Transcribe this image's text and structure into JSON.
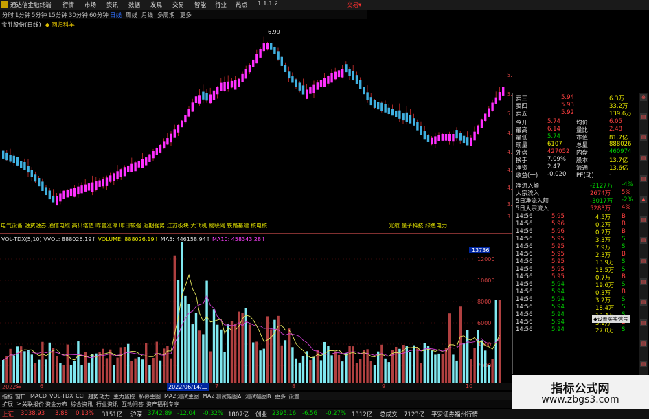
{
  "menubar": {
    "title": "通达信金融终端",
    "items": [
      "行情",
      "市场",
      "资讯",
      "数据",
      "发现",
      "交易",
      "智能",
      "行业",
      "热点",
      "1.1.1.2"
    ],
    "trade": "交易▾"
  },
  "periods": [
    "分时",
    "1分钟",
    "5分钟",
    "15分钟",
    "30分钟",
    "60分钟",
    "日线",
    "周线",
    "月线",
    "多周期",
    "更多"
  ],
  "active_period": "日线",
  "stock_header": {
    "name": "宝胜股份(日线)",
    "warn": "◆ 回归科羊"
  },
  "price_axis": [
    "5.50",
    "5.25",
    "5.00",
    "4.75",
    "4.50",
    "4.25",
    "4.00",
    "3.75",
    "3.50"
  ],
  "high_mark": "6.99",
  "concepts_left": "电气设备 融资融券 通信电缆 高贝塔值 昨曾涨停 昨日较强 近期强势 江苏板块 大飞机 物联网 铁路基建 核电核",
  "concepts_right": "光缆 量子科技 绿色电力",
  "vol_legend": {
    "label": "VOL-TDX(5,10)",
    "vvol": "VVOL: 888026.19↑",
    "volume": "VOLUME: 888026.19↑",
    "ma5": "MA5: 446158.94↑",
    "ma10": "MA10: 458343.28↑"
  },
  "vol_axis_top": "13736",
  "vol_axis": [
    "12000",
    "10000",
    "8000",
    "6000",
    "4000",
    "2000"
  ],
  "date_axis": {
    "left": "2022年",
    "cursor": "2022/06/14/二",
    "marks": [
      "6",
      "7",
      "8",
      "9",
      "10"
    ]
  },
  "bottom_tabs": [
    "指标",
    "窗口",
    "MACD",
    "VOL-TDX",
    "CCI",
    "趋势动力",
    "主力监控",
    "私募主图",
    "MA2",
    "测试主图",
    "MA2",
    "测试幅图A",
    "测试幅图B",
    "更多",
    "设置"
  ],
  "bottom_tabs2": [
    "扩展",
    ">",
    "关联报价",
    "资金分布",
    "综合资讯",
    "行业资讯",
    "互动问答",
    "资产福利专享"
  ],
  "right_panel": {
    "asks": [
      {
        "label": "卖三",
        "price": "5.94",
        "vol": "6.3万"
      },
      {
        "label": "卖四",
        "price": "5.93",
        "vol": "33.2万"
      },
      {
        "label": "卖五",
        "price": "5.92",
        "vol": "139.6万"
      }
    ],
    "stats": [
      {
        "l1": "今开",
        "v1": "5.74",
        "l2": "均价",
        "v2": "6.05"
      },
      {
        "l1": "最高",
        "v1": "6.14",
        "l2": "量比",
        "v2": "2.48"
      },
      {
        "l1": "最低",
        "v1": "5.74",
        "l2": "市值",
        "v2": "81.7亿"
      },
      {
        "l1": "现量",
        "v1": "6107",
        "l2": "总量",
        "v2": "888026"
      },
      {
        "l1": "外盘",
        "v1": "427052",
        "l2": "内盘",
        "v2": "460974"
      },
      {
        "l1": "换手",
        "v1": "7.09%",
        "l2": "股本",
        "v2": "13.7亿"
      },
      {
        "l1": "净资",
        "v1": "2.47",
        "l2": "流通",
        "v2": "13.6亿"
      },
      {
        "l1": "收益(一)",
        "v1": "-0.020",
        "l2": "PE(动)",
        "v2": "-"
      }
    ],
    "flows": [
      {
        "label": "净流入额",
        "value": "-2127万",
        "pct": "-4%"
      },
      {
        "label": "大宗流入",
        "value": "2674万",
        "pct": "5%"
      },
      {
        "label": "5日净流入额",
        "value": "-3017万",
        "pct": "-2%"
      },
      {
        "label": "5日大宗流入",
        "value": "5283万",
        "pct": "4%"
      }
    ],
    "ticks": [
      {
        "t": "14:56",
        "p": "5.95",
        "v": "4.5万",
        "s": "B"
      },
      {
        "t": "14:56",
        "p": "5.96",
        "p2": "",
        "v": "0.2万",
        "s": "B"
      },
      {
        "t": "14:56",
        "p": "5.96",
        "v": "0.2万",
        "s": "B"
      },
      {
        "t": "14:56",
        "p": "5.95",
        "v": "3.3万",
        "s": "S"
      },
      {
        "t": "14:56",
        "p": "5.95",
        "v": "7.9万",
        "s": "S"
      },
      {
        "t": "14:56",
        "p": "5.95",
        "v": "2.3万",
        "s": "B"
      },
      {
        "t": "14:56",
        "p": "5.95",
        "v": "13.9万",
        "s": "S"
      },
      {
        "t": "14:56",
        "p": "5.95",
        "v": "13.5万",
        "s": "S"
      },
      {
        "t": "14:56",
        "p": "5.95",
        "v": "0.7万",
        "s": "B"
      },
      {
        "t": "14:56",
        "p": "5.94",
        "v": "19.6万",
        "s": "S"
      },
      {
        "t": "14:56",
        "p": "5.94",
        "v": "0.3万",
        "s": "B"
      },
      {
        "t": "14:56",
        "p": "5.94",
        "v": "3.2万",
        "s": "S"
      },
      {
        "t": "14:56",
        "p": "5.94",
        "v": "18.4万",
        "s": "S"
      },
      {
        "t": "14:56",
        "p": "5.94",
        "v": "12.4万",
        "s": "S"
      },
      {
        "t": "14:56",
        "p": "5.94",
        "v": "3.1万",
        "s": "B"
      },
      {
        "t": "14:56",
        "p": "5.94",
        "v": "27.0万",
        "s": "S"
      }
    ],
    "tooltip": "◆设置买卖信号"
  },
  "status": {
    "sh": "上证",
    "sh_val": "3038.93",
    "sh_chg": "3.88",
    "sh_pct": "0.13%",
    "sh_amt": "3151亿",
    "sz": "沪深",
    "sz_val": "3742.89",
    "sz_chg": "-12.04",
    "sz_pct": "-0.32%",
    "sz_amt": "1807亿",
    "cy": "创业",
    "cy_val": "2395.16",
    "cy_chg": "-6.56",
    "cy_pct": "-0.27%",
    "cy_amt": "1312亿",
    "total_label": "总成交",
    "total": "7123亿",
    "broker": "平安证券福州行情"
  },
  "watermark": {
    "line1": "指标公式网",
    "line2": "www.zbgs3.com"
  },
  "colors": {
    "bg": "#000000",
    "up": "#ff4040",
    "down": "#00d000",
    "candle_up": "#ff30ff",
    "candle_down": "#40b0e0",
    "vol_up": "#b04040",
    "vol_down": "#80e8f0"
  }
}
